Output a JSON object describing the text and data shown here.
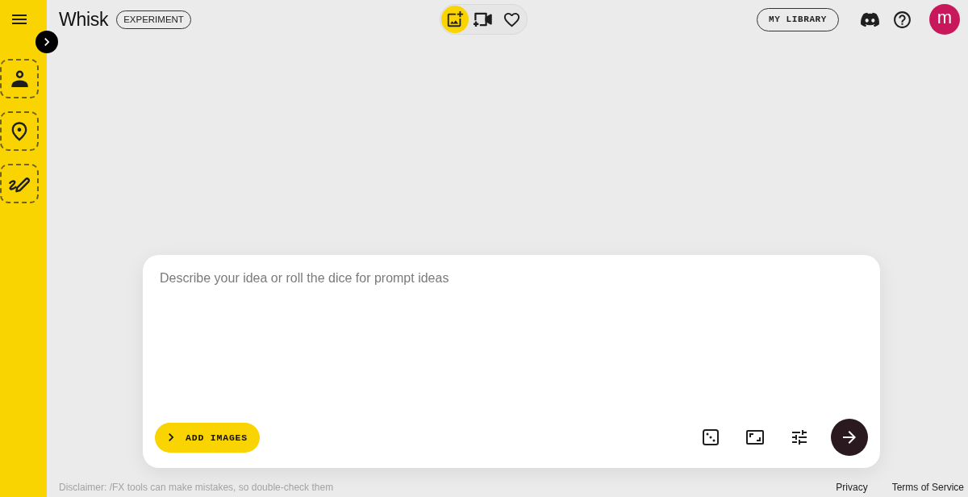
{
  "header": {
    "title": "Whisk",
    "badge": "EXPERIMENT",
    "modes": [
      {
        "kind": "image",
        "selected": true
      },
      {
        "kind": "video",
        "selected": false
      },
      {
        "kind": "favorites",
        "selected": false
      }
    ],
    "library_button": "MY LIBRARY",
    "avatar": "m"
  },
  "sidebar": {
    "items": [
      {
        "kind": "subject"
      },
      {
        "kind": "scene"
      },
      {
        "kind": "style"
      }
    ]
  },
  "prompt": {
    "placeholder": "Describe your idea or roll the dice for prompt ideas",
    "add_images_button": "ADD IMAGES"
  },
  "footer": {
    "disclaimer": "Disclaimer: /FX tools can make mistakes, so double-check them",
    "links": [
      "Privacy",
      "Terms of Service"
    ]
  }
}
